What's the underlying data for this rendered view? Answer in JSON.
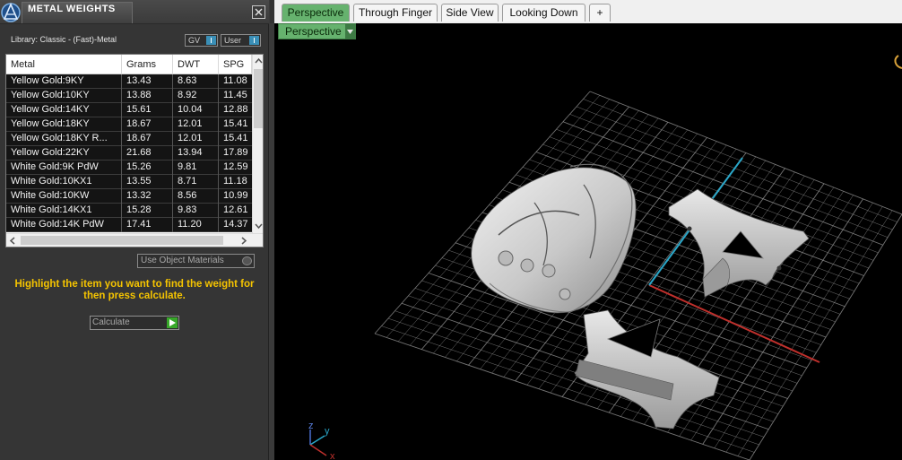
{
  "panel": {
    "title": "METAL WEIGHTS",
    "library_label": "Library: Classic - (Fast)-Metal",
    "gv_label": "GV",
    "user_label": "User",
    "use_object_materials_label": "Use Object Materials",
    "hint": "Highlight the item you want to find the weight for then press calculate.",
    "calculate_label": "Calculate"
  },
  "table": {
    "columns": [
      "Metal",
      "Grams",
      "DWT",
      "SPG"
    ],
    "rows": [
      [
        "Yellow Gold:9KY",
        "13.43",
        "8.63",
        "11.08"
      ],
      [
        "Yellow Gold:10KY",
        "13.88",
        "8.92",
        "11.45"
      ],
      [
        "Yellow Gold:14KY",
        "15.61",
        "10.04",
        "12.88"
      ],
      [
        "Yellow Gold:18KY",
        "18.67",
        "12.01",
        "15.41"
      ],
      [
        "Yellow Gold:18KY R...",
        "18.67",
        "12.01",
        "15.41"
      ],
      [
        "Yellow Gold:22KY",
        "21.68",
        "13.94",
        "17.89"
      ],
      [
        "White Gold:9K PdW",
        "15.26",
        "9.81",
        "12.59"
      ],
      [
        "White Gold:10KX1",
        "13.55",
        "8.71",
        "11.18"
      ],
      [
        "White Gold:10KW",
        "13.32",
        "8.56",
        "10.99"
      ],
      [
        "White Gold:14KX1",
        "15.28",
        "9.83",
        "12.61"
      ],
      [
        "White Gold:14K PdW",
        "17.41",
        "11.20",
        "14.37"
      ]
    ]
  },
  "viewport": {
    "tabs": [
      "Perspective",
      "Through Finger",
      "Side View",
      "Looking Down",
      "+"
    ],
    "active_tab": "Perspective",
    "view_dropdown": "Perspective",
    "axis_labels": {
      "x": "x",
      "y": "y",
      "z": "z"
    }
  },
  "colors": {
    "accent_green": "#66b26e",
    "hint_yellow": "#f5c400",
    "grid": "#9a9a9a",
    "axis_red": "#c0302c",
    "axis_cyan": "#2aa6c8"
  }
}
